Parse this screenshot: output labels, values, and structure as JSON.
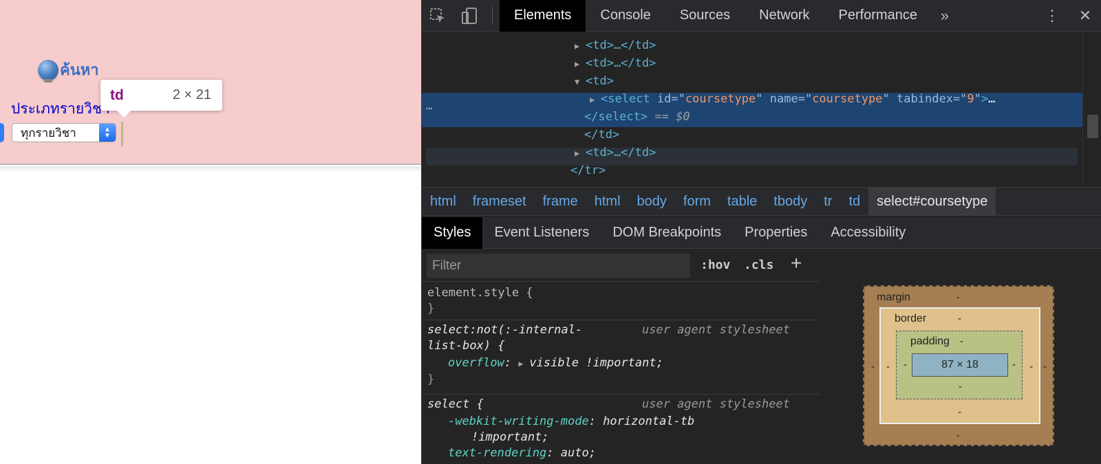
{
  "page": {
    "search_link": "ค้นหา",
    "course_label": "ประเภทรายวิชา",
    "select_value": "ทุกรายวิชา",
    "tooltip_tag": "td",
    "tooltip_size": "2 × 21",
    "colors": {
      "background": "#f6cccc",
      "label": "#0000cc",
      "link": "#3a6fc4"
    }
  },
  "devtools": {
    "tabs": [
      "Elements",
      "Console",
      "Sources",
      "Network",
      "Performance"
    ],
    "active_tab": "Elements",
    "more_tabs": "»",
    "menu": "⋮",
    "close": "✕",
    "dom": {
      "lines": [
        "<td>…</td>",
        "<td>…</td>",
        "<td>"
      ],
      "select_tag": "select",
      "select_attrs": [
        {
          "name": "id",
          "value": "coursetype"
        },
        {
          "name": "name",
          "value": "coursetype"
        },
        {
          "name": "tabindex",
          "value": "9"
        }
      ],
      "select_close": "</select>",
      "dollar_ref": "== $0",
      "td_close": "</td>",
      "td_collapsed": "<td>…</td>",
      "tr_close": "</tr>",
      "dots": "…",
      "selection_color": "#1e4471"
    },
    "breadcrumbs": [
      "html",
      "frameset",
      "frame",
      "html",
      "body",
      "form",
      "table",
      "tbody",
      "tr",
      "td",
      "select#coursetype"
    ],
    "subtabs": [
      "Styles",
      "Event Listeners",
      "DOM Breakpoints",
      "Properties",
      "Accessibility"
    ],
    "active_subtab": "Styles",
    "styles": {
      "filter_placeholder": "Filter",
      "hov": ":hov",
      "cls": ".cls",
      "add": "+",
      "rules": [
        {
          "selector": "element.style {",
          "close": "}"
        },
        {
          "selector": "select:not(:-internal-",
          "selector_cont": "list-box) {",
          "source": "user agent stylesheet",
          "prop": "overflow",
          "value": "visible !important;",
          "close": "}"
        },
        {
          "selector": "select {",
          "source": "user agent stylesheet",
          "prop": "-webkit-writing-mode",
          "value": "horizontal-tb",
          "value_cont": "!important;",
          "prop2": "text-rendering",
          "value2": "auto;"
        }
      ]
    },
    "box_model": {
      "margin": "margin",
      "border": "border",
      "padding": "padding",
      "content": "87 × 18",
      "empty": "-"
    }
  }
}
